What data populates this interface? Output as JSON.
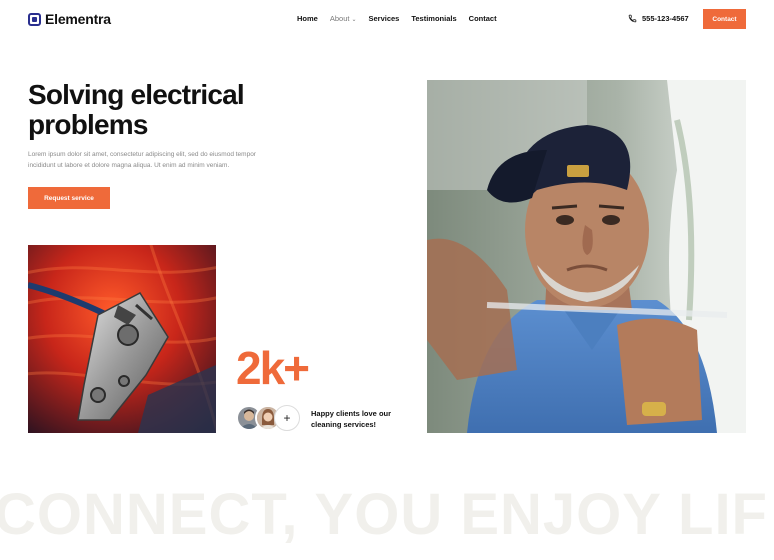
{
  "brand": {
    "name": "Elementra",
    "accent": "#ef6a3a",
    "logo_color": "#2a2f8f"
  },
  "nav": {
    "items": [
      {
        "label": "Home"
      },
      {
        "label": "About",
        "has_dropdown": true
      },
      {
        "label": "Services"
      },
      {
        "label": "Testimonials"
      },
      {
        "label": "Contact"
      }
    ]
  },
  "header": {
    "phone": "555-123-4567",
    "phone_icon": "phone-icon",
    "cta_label": "Contact"
  },
  "hero": {
    "title_line1": "Solving electrical",
    "title_line2": "problems",
    "description": "Lorem ipsum dolor sit amet, consectetur adipiscing elit, sed do eiusmod tempor incididunt ut labore et dolore magna aliqua. Ut enim ad minim veniam.",
    "button_label": "Request service"
  },
  "stats": {
    "value": "2k+",
    "caption": "Happy clients love our cleaning services!",
    "plus_symbol": "+"
  },
  "marquee": {
    "text": "CONNECT, YOU ENJOY LIF"
  }
}
